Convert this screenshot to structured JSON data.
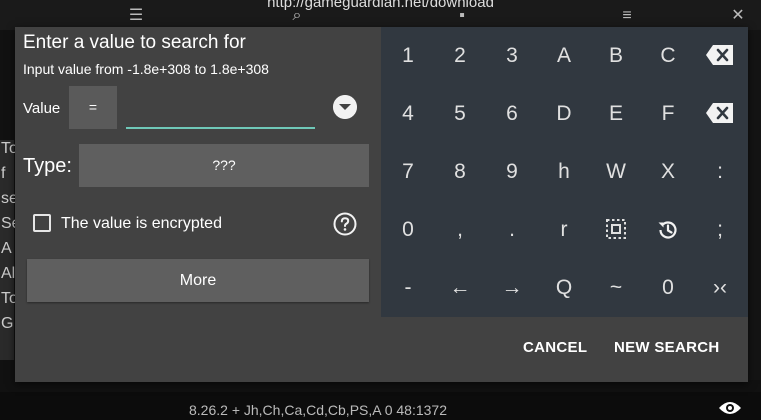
{
  "background": {
    "url": "http://gameguardian.net/download",
    "left_strip": [
      "To",
      "f",
      "se",
      "Se",
      "A",
      "Al",
      "To",
      "G"
    ],
    "status_text": "8.26.2 + Jh,Ch,Ca,Cd,Cb,PS,A 0 48:1372"
  },
  "dialog": {
    "title": "Enter a value to search for",
    "subtitle": "Input value from -1.8e+308 to 1.8e+308",
    "value_label": "Value",
    "operator": "=",
    "value_input": "",
    "type_label": "Type:",
    "type_value": "???",
    "encrypted_label": "The value is encrypted",
    "encrypted_checked": false,
    "more_label": "More",
    "cancel_label": "CANCEL",
    "new_search_label": "NEW SEARCH",
    "accent_color": "#6fc8b8"
  },
  "keypad": {
    "keys": [
      "1",
      "2",
      "3",
      "A",
      "B",
      "C",
      "backspace-icon",
      "4",
      "5",
      "6",
      "D",
      "E",
      "F",
      "clear-icon",
      "7",
      "8",
      "9",
      "h",
      "W",
      "X",
      ":",
      "0",
      ",",
      ".",
      "r",
      "select-icon",
      "history-icon",
      ";",
      "-",
      "←",
      "→",
      "Q",
      "~",
      "0",
      "›‹"
    ]
  }
}
